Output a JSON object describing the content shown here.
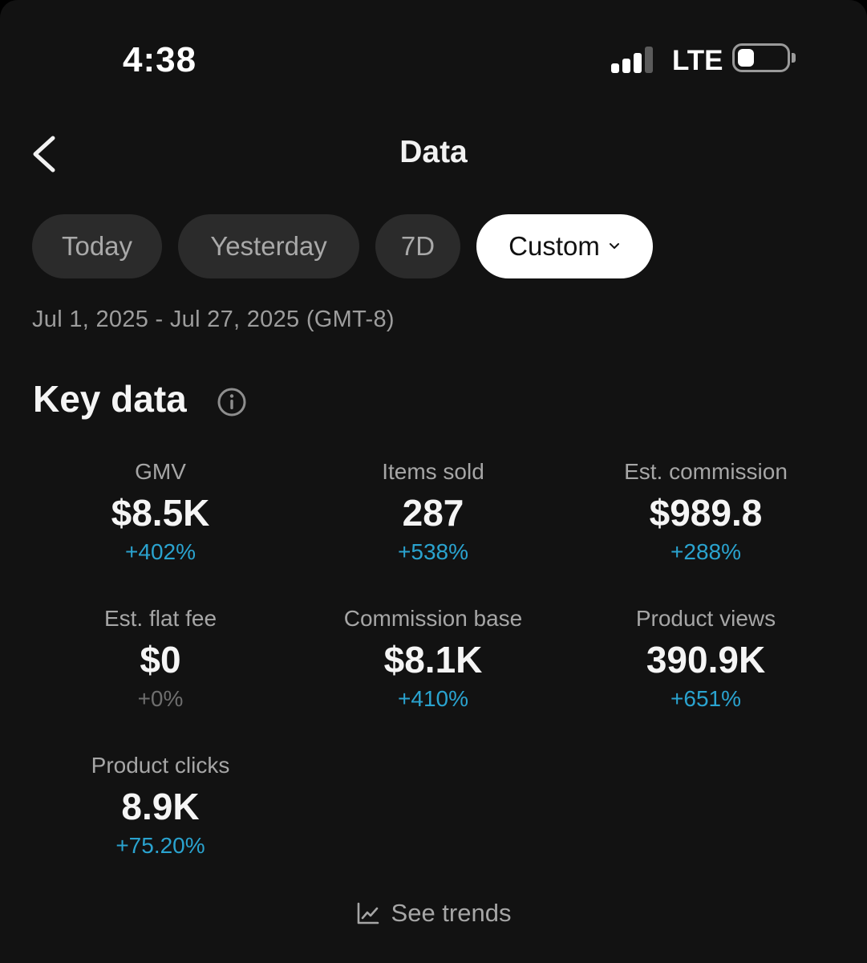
{
  "status_bar": {
    "time": "4:38",
    "network": "LTE",
    "icons": [
      "signal-icon",
      "battery-icon"
    ]
  },
  "header": {
    "title": "Data",
    "back_icon": "chevron-left-icon"
  },
  "tabs": [
    {
      "label": "Today",
      "selected": false
    },
    {
      "label": "Yesterday",
      "selected": false
    },
    {
      "label": "7D",
      "selected": false
    },
    {
      "label": "Custom",
      "selected": true,
      "icon": "chevron-down-icon"
    }
  ],
  "date_range": "Jul 1, 2025 - Jul 27, 2025 (GMT-8)",
  "key_data": {
    "title": "Key data",
    "info_icon": "info-icon",
    "metrics": [
      {
        "label": "GMV",
        "value": "$8.5K",
        "change": "+402%"
      },
      {
        "label": "Items sold",
        "value": "287",
        "change": "+538%"
      },
      {
        "label": "Est. commission",
        "value": "$989.8",
        "change": "+288%"
      },
      {
        "label": "Est. flat fee",
        "value": "$0",
        "change": "+0%"
      },
      {
        "label": "Commission base",
        "value": "$8.1K",
        "change": "+410%"
      },
      {
        "label": "Product views",
        "value": "390.9K",
        "change": "+651%"
      },
      {
        "label": "Product clicks",
        "value": "8.9K",
        "change": "+75.20%"
      }
    ]
  },
  "footer": {
    "see_trends_label": "See trends",
    "icon": "line-chart-icon"
  },
  "colors": {
    "background": "#121212",
    "positive_change": "#2aa3cf",
    "neutral_change": "#6e6e6e",
    "tab_bg": "#2b2b2b",
    "tab_selected_bg": "#ffffff"
  }
}
